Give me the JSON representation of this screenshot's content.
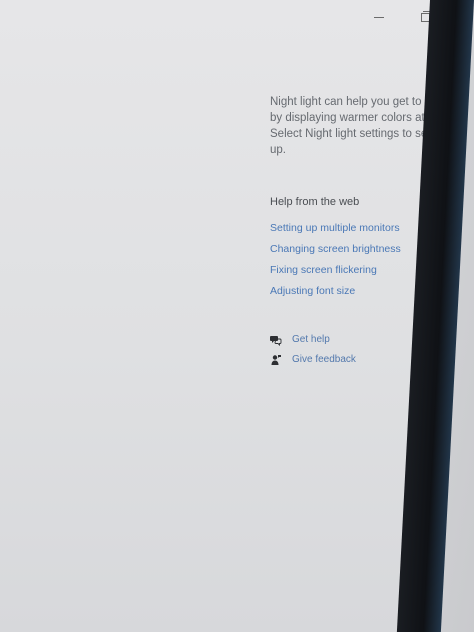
{
  "window": {
    "controls": {
      "minimize_icon": "minimize-icon",
      "restore_icon": "restore-icon"
    }
  },
  "night_light": {
    "description": "Night light can help you get to sleep by displaying warmer colors at night. Select Night light settings to set things up."
  },
  "help_from_web": {
    "heading": "Help from the web",
    "links": [
      "Setting up multiple monitors",
      "Changing screen brightness",
      "Fixing screen flickering",
      "Adjusting font size"
    ]
  },
  "actions": {
    "get_help": "Get help",
    "give_feedback": "Give feedback"
  },
  "colors": {
    "link": "#4a78b6",
    "text": "#666a70",
    "bezel": "#0f1115"
  }
}
